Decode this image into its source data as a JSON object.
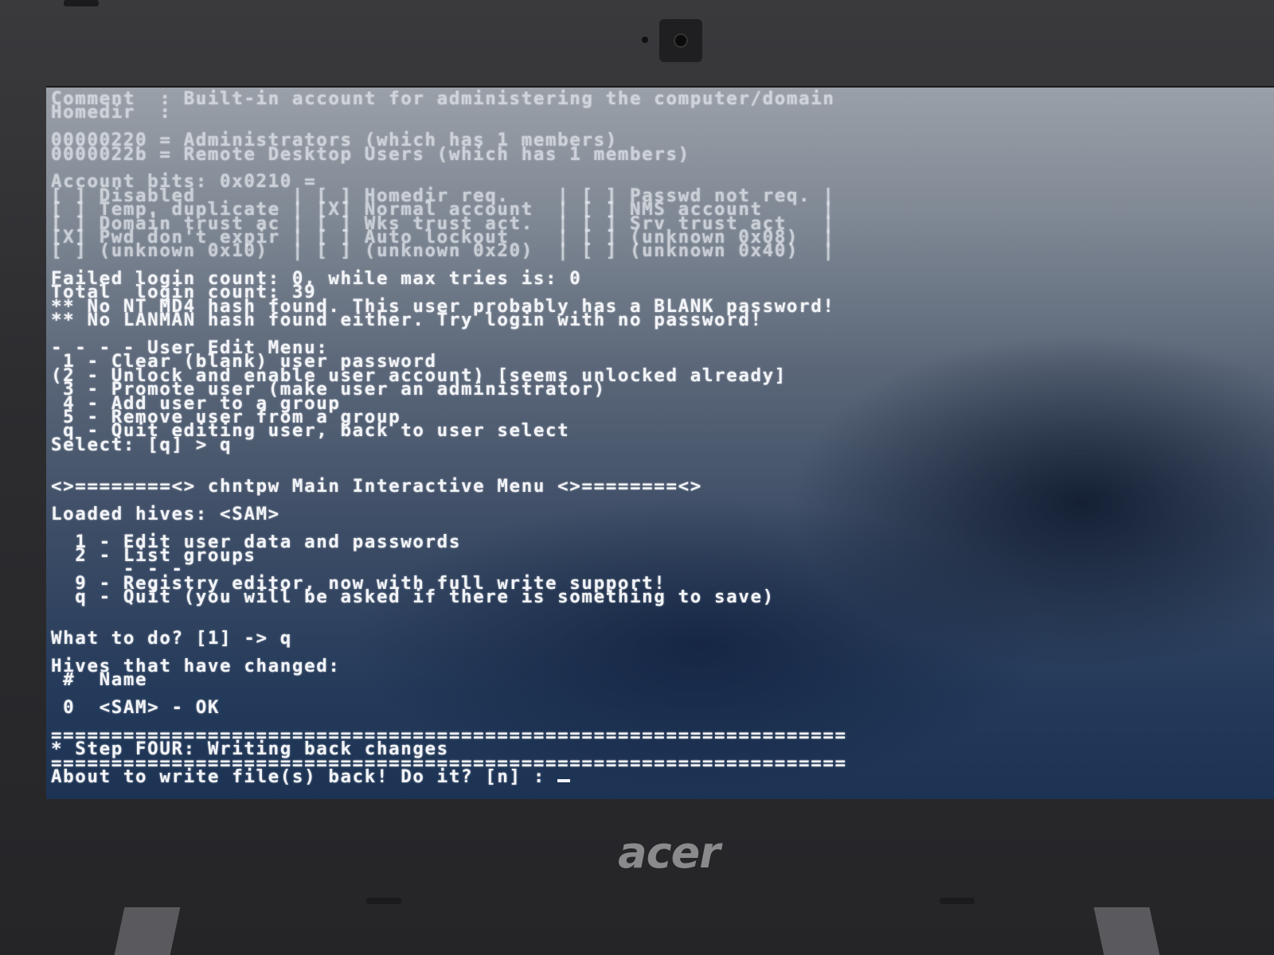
{
  "terminal": {
    "lines": [
      "Comment  : Built-in account for administering the computer/domain",
      "Homedir  :",
      "",
      "00000220 = Administrators (which has 1 members)",
      "0000022b = Remote Desktop Users (which has 1 members)",
      "",
      "Account bits: 0x0210 =",
      "[ ] Disabled        | [ ] Homedir req.    | [ ] Passwd not req. |",
      "[ ] Temp. duplicate | [X] Normal account  | [ ] NMS account     |",
      "[ ] Domain trust ac | [ ] Wks trust act.  | [ ] Srv trust act   |",
      "[X] Pwd don't expir | [ ] Auto lockout    | [ ] (unknown 0x08)  |",
      "[ ] (unknown 0x10)  | [ ] (unknown 0x20)  | [ ] (unknown 0x40)  |",
      "",
      "Failed login count: 0, while max tries is: 0",
      "Total  login count: 39",
      "** No NT MD4 hash found. This user probably has a BLANK password!",
      "** No LANMAN hash found either. Try login with no password!",
      "",
      "- - - - User Edit Menu:",
      " 1 - Clear (blank) user password",
      "(2 - Unlock and enable user account) [seems unlocked already]",
      " 3 - Promote user (make user an administrator)",
      " 4 - Add user to a group",
      " 5 - Remove user from a group",
      " q - Quit editing user, back to user select",
      "Select: [q] > q",
      "",
      "",
      "<>========<> chntpw Main Interactive Menu <>========<>",
      "",
      "Loaded hives: <SAM>",
      "",
      "  1 - Edit user data and passwords",
      "  2 - List groups",
      "      - - -",
      "  9 - Registry editor, now with full write support!",
      "  q - Quit (you will be asked if there is something to save)",
      "",
      "",
      "What to do? [1] -> q",
      "",
      "Hives that have changed:",
      " #  Name",
      "",
      " 0  <SAM> - OK",
      "",
      "==================================================================",
      "* Step FOUR: Writing back changes",
      "==================================================================",
      "About to write file(s) back! Do it? [n] : "
    ],
    "faded_line_count": 12
  },
  "brand": {
    "logo_text": "acer"
  }
}
